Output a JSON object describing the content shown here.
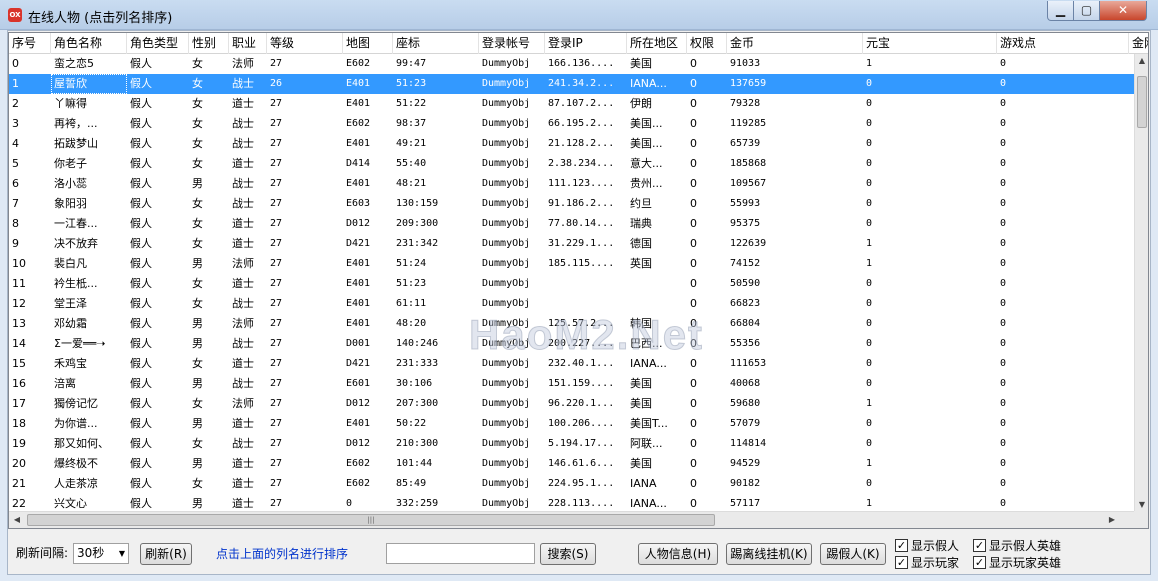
{
  "window": {
    "title": "在线人物 (点击列名排序)",
    "icon_text": "OX",
    "min_symbol": "▁",
    "max_symbol": "▢",
    "close_symbol": "✕"
  },
  "columns": [
    "序号",
    "角色名称",
    "角色类型",
    "性别",
    "职业",
    "等级",
    "地图",
    "座标",
    "登录帐号",
    "登录IP",
    "所在地区",
    "权限",
    "金币",
    "元宝",
    "游戏点",
    "金刚"
  ],
  "rows": [
    [
      "0",
      "蛮之恋5",
      "假人",
      "女",
      "法师",
      "27",
      "E602",
      "99:47",
      "DummyObj",
      "166.136....",
      "美国",
      "0",
      "91033",
      "1",
      "0"
    ],
    [
      "1",
      "屋誓欣",
      "假人",
      "女",
      "战士",
      "26",
      "E401",
      "51:23",
      "DummyObj",
      "241.34.2...",
      "IANA...",
      "0",
      "137659",
      "0",
      "0"
    ],
    [
      "2",
      "丫嘛得",
      "假人",
      "女",
      "道士",
      "27",
      "E401",
      "51:22",
      "DummyObj",
      "87.107.2...",
      "伊朗",
      "0",
      "79328",
      "0",
      "0"
    ],
    [
      "3",
      "再袴，...",
      "假人",
      "女",
      "战士",
      "27",
      "E602",
      "98:37",
      "DummyObj",
      "66.195.2...",
      "美国...",
      "0",
      "119285",
      "0",
      "0"
    ],
    [
      "4",
      "拓跋梦山",
      "假人",
      "女",
      "战士",
      "27",
      "E401",
      "49:21",
      "DummyObj",
      "21.128.2...",
      "美国...",
      "0",
      "65739",
      "0",
      "0"
    ],
    [
      "5",
      "你老子",
      "假人",
      "女",
      "道士",
      "27",
      "D414",
      "55:40",
      "DummyObj",
      "2.38.234...",
      "意大...",
      "0",
      "185868",
      "0",
      "0"
    ],
    [
      "6",
      "洛小蕊",
      "假人",
      "男",
      "战士",
      "27",
      "E401",
      "48:21",
      "DummyObj",
      "111.123....",
      "贵州...",
      "0",
      "109567",
      "0",
      "0"
    ],
    [
      "7",
      "象阳羽",
      "假人",
      "女",
      "战士",
      "27",
      "E603",
      "130:159",
      "DummyObj",
      "91.186.2...",
      "约旦",
      "0",
      "55993",
      "0",
      "0"
    ],
    [
      "8",
      "一江春...",
      "假人",
      "女",
      "道士",
      "27",
      "D012",
      "209:300",
      "DummyObj",
      "77.80.14...",
      "瑞典",
      "0",
      "95375",
      "0",
      "0"
    ],
    [
      "9",
      "决不放弃",
      "假人",
      "女",
      "道士",
      "27",
      "D421",
      "231:342",
      "DummyObj",
      "31.229.1...",
      "德国",
      "0",
      "122639",
      "1",
      "0"
    ],
    [
      "10",
      "裴白凡",
      "假人",
      "男",
      "法师",
      "27",
      "E401",
      "51:24",
      "DummyObj",
      "185.115....",
      "英国",
      "0",
      "74152",
      "1",
      "0"
    ],
    [
      "11",
      "衿生柢...",
      "假人",
      "女",
      "道士",
      "27",
      "E401",
      "51:23",
      "DummyObj",
      "",
      "",
      "0",
      "50590",
      "0",
      "0"
    ],
    [
      "12",
      "堂王泽",
      "假人",
      "女",
      "战士",
      "27",
      "E401",
      "61:11",
      "DummyObj",
      "",
      "",
      "0",
      "66823",
      "0",
      "0"
    ],
    [
      "13",
      "邓幼霜",
      "假人",
      "男",
      "法师",
      "27",
      "E401",
      "48:20",
      "DummyObj",
      "125.57.2...",
      "韩国",
      "0",
      "66804",
      "0",
      "0"
    ],
    [
      "14",
      "Σ一爱══➝",
      "假人",
      "男",
      "战士",
      "27",
      "D001",
      "140:246",
      "DummyObj",
      "200.227....",
      "巴西...",
      "0",
      "55356",
      "0",
      "0"
    ],
    [
      "15",
      "禾鸡宝",
      "假人",
      "女",
      "道士",
      "27",
      "D421",
      "231:333",
      "DummyObj",
      "232.40.1...",
      "IANA...",
      "0",
      "111653",
      "0",
      "0"
    ],
    [
      "16",
      "涪离",
      "假人",
      "男",
      "战士",
      "27",
      "E601",
      "30:106",
      "DummyObj",
      "151.159....",
      "美国",
      "0",
      "40068",
      "0",
      "0"
    ],
    [
      "17",
      "獨傍记忆",
      "假人",
      "女",
      "法师",
      "27",
      "D012",
      "207:300",
      "DummyObj",
      "96.220.1...",
      "美国",
      "0",
      "59680",
      "1",
      "0"
    ],
    [
      "18",
      "为你谱...",
      "假人",
      "男",
      "道士",
      "27",
      "E401",
      "50:22",
      "DummyObj",
      "100.206....",
      "美国T...",
      "0",
      "57079",
      "0",
      "0"
    ],
    [
      "19",
      "那又如何、",
      "假人",
      "女",
      "战士",
      "27",
      "D012",
      "210:300",
      "DummyObj",
      "5.194.17...",
      "阿联...",
      "0",
      "114814",
      "0",
      "0"
    ],
    [
      "20",
      "爆终极不",
      "假人",
      "男",
      "道士",
      "27",
      "E602",
      "101:44",
      "DummyObj",
      "146.61.6...",
      "美国",
      "0",
      "94529",
      "1",
      "0"
    ],
    [
      "21",
      "人走茶凉",
      "假人",
      "女",
      "道士",
      "27",
      "E602",
      "85:49",
      "DummyObj",
      "224.95.1...",
      "IANA",
      "0",
      "90182",
      "0",
      "0"
    ],
    [
      "22",
      "兴文心",
      "假人",
      "男",
      "道士",
      "27",
      "0",
      "332:259",
      "DummyObj",
      "228.113....",
      "IANA...",
      "0",
      "57117",
      "1",
      "0"
    ]
  ],
  "selected_row": 1,
  "watermark": "HaoM2.Net",
  "scroll": {
    "up": "▲",
    "down": "▼",
    "left": "◀",
    "right": "▶",
    "grip": "|||"
  },
  "bottom": {
    "refresh_interval_label": "刷新间隔:",
    "refresh_interval_value": "30秒",
    "refresh_button": "刷新(R)",
    "sort_hint": "点击上面的列名进行排序",
    "search_value": "",
    "search_button": "搜索(S)",
    "info_button": "人物信息(H)",
    "kick_offline_button": "踢离线挂机(K)",
    "kick_fake_button": "踢假人(K)",
    "check_show_fake": "显示假人",
    "check_show_fake_hero": "显示假人英雄",
    "check_show_player": "显示玩家",
    "check_show_player_hero": "显示玩家英雄",
    "check_mark": "✓",
    "select_arrow": "▼"
  },
  "colors": {
    "selection": "#3399ff",
    "hint_text": "#0033cc"
  }
}
